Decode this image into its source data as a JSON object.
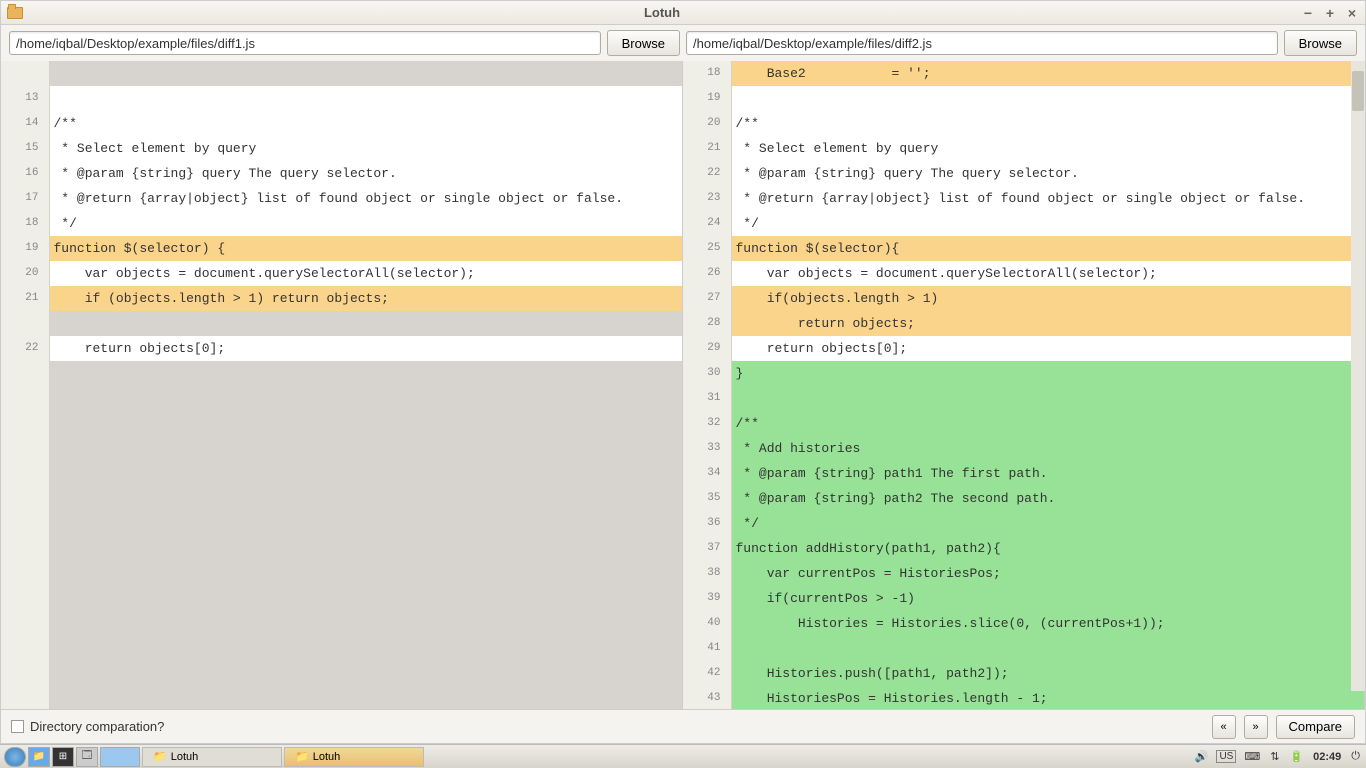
{
  "window": {
    "title": "Lotuh"
  },
  "left": {
    "path": "/home/iqbal/Desktop/example/files/diff1.js",
    "browse": "Browse",
    "rows": [
      {
        "n": "",
        "t": "",
        "cls": "blank"
      },
      {
        "n": "13",
        "t": "",
        "cls": ""
      },
      {
        "n": "14",
        "t": "/**",
        "cls": ""
      },
      {
        "n": "15",
        "t": " * Select element by query",
        "cls": ""
      },
      {
        "n": "16",
        "t": " * @param {string} query The query selector.",
        "cls": ""
      },
      {
        "n": "17",
        "t": " * @return {array|object} list of found object or single object or false.",
        "cls": ""
      },
      {
        "n": "18",
        "t": " */",
        "cls": ""
      },
      {
        "n": "19",
        "t": "function $(selector) {",
        "cls": "diff"
      },
      {
        "n": "20",
        "t": "    var objects = document.querySelectorAll(selector);",
        "cls": ""
      },
      {
        "n": "21",
        "t": "    if (objects.length > 1) return objects;",
        "cls": "diff"
      },
      {
        "n": "",
        "t": "",
        "cls": "blank"
      },
      {
        "n": "22",
        "t": "    return objects[0];",
        "cls": ""
      },
      {
        "n": "",
        "t": "",
        "cls": "blank"
      },
      {
        "n": "",
        "t": "",
        "cls": "blank"
      },
      {
        "n": "",
        "t": "",
        "cls": "blank"
      },
      {
        "n": "",
        "t": "",
        "cls": "blank"
      },
      {
        "n": "",
        "t": "",
        "cls": "blank"
      },
      {
        "n": "",
        "t": "",
        "cls": "blank"
      },
      {
        "n": "",
        "t": "",
        "cls": "blank"
      },
      {
        "n": "",
        "t": "",
        "cls": "blank"
      },
      {
        "n": "",
        "t": "",
        "cls": "blank"
      },
      {
        "n": "",
        "t": "",
        "cls": "blank"
      },
      {
        "n": "",
        "t": "",
        "cls": "blank"
      },
      {
        "n": "",
        "t": "",
        "cls": "blank"
      },
      {
        "n": "",
        "t": "",
        "cls": "blank"
      },
      {
        "n": "",
        "t": "",
        "cls": "blank"
      }
    ]
  },
  "right": {
    "path": "/home/iqbal/Desktop/example/files/diff2.js",
    "browse": "Browse",
    "rows": [
      {
        "n": "18",
        "t": "    Base2           = '';",
        "cls": "diff"
      },
      {
        "n": "19",
        "t": "",
        "cls": ""
      },
      {
        "n": "20",
        "t": "/**",
        "cls": ""
      },
      {
        "n": "21",
        "t": " * Select element by query",
        "cls": ""
      },
      {
        "n": "22",
        "t": " * @param {string} query The query selector.",
        "cls": ""
      },
      {
        "n": "23",
        "t": " * @return {array|object} list of found object or single object or false.",
        "cls": ""
      },
      {
        "n": "24",
        "t": " */",
        "cls": ""
      },
      {
        "n": "25",
        "t": "function $(selector){",
        "cls": "diff"
      },
      {
        "n": "26",
        "t": "    var objects = document.querySelectorAll(selector);",
        "cls": ""
      },
      {
        "n": "27",
        "t": "    if(objects.length > 1)",
        "cls": "diff"
      },
      {
        "n": "28",
        "t": "        return objects;",
        "cls": "diff"
      },
      {
        "n": "29",
        "t": "    return objects[0];",
        "cls": ""
      },
      {
        "n": "30",
        "t": "}",
        "cls": "add"
      },
      {
        "n": "31",
        "t": "",
        "cls": "add"
      },
      {
        "n": "32",
        "t": "/**",
        "cls": "add"
      },
      {
        "n": "33",
        "t": " * Add histories",
        "cls": "add"
      },
      {
        "n": "34",
        "t": " * @param {string} path1 The first path.",
        "cls": "add"
      },
      {
        "n": "35",
        "t": " * @param {string} path2 The second path.",
        "cls": "add"
      },
      {
        "n": "36",
        "t": " */",
        "cls": "add"
      },
      {
        "n": "37",
        "t": "function addHistory(path1, path2){",
        "cls": "add"
      },
      {
        "n": "38",
        "t": "    var currentPos = HistoriesPos;",
        "cls": "add"
      },
      {
        "n": "39",
        "t": "    if(currentPos > -1)",
        "cls": "add"
      },
      {
        "n": "40",
        "t": "        Histories = Histories.slice(0, (currentPos+1));",
        "cls": "add"
      },
      {
        "n": "41",
        "t": "",
        "cls": "add"
      },
      {
        "n": "42",
        "t": "    Histories.push([path1, path2]);",
        "cls": "add"
      },
      {
        "n": "43",
        "t": "    HistoriesPos = Histories.length - 1;",
        "cls": "add"
      }
    ]
  },
  "footer": {
    "checkbox_label": "Directory comparation?",
    "prev": "«",
    "next": "»",
    "compare": "Compare"
  },
  "taskbar": {
    "task1": "Lotuh",
    "task2": "Lotuh",
    "lang": "US",
    "time": "02:49"
  }
}
